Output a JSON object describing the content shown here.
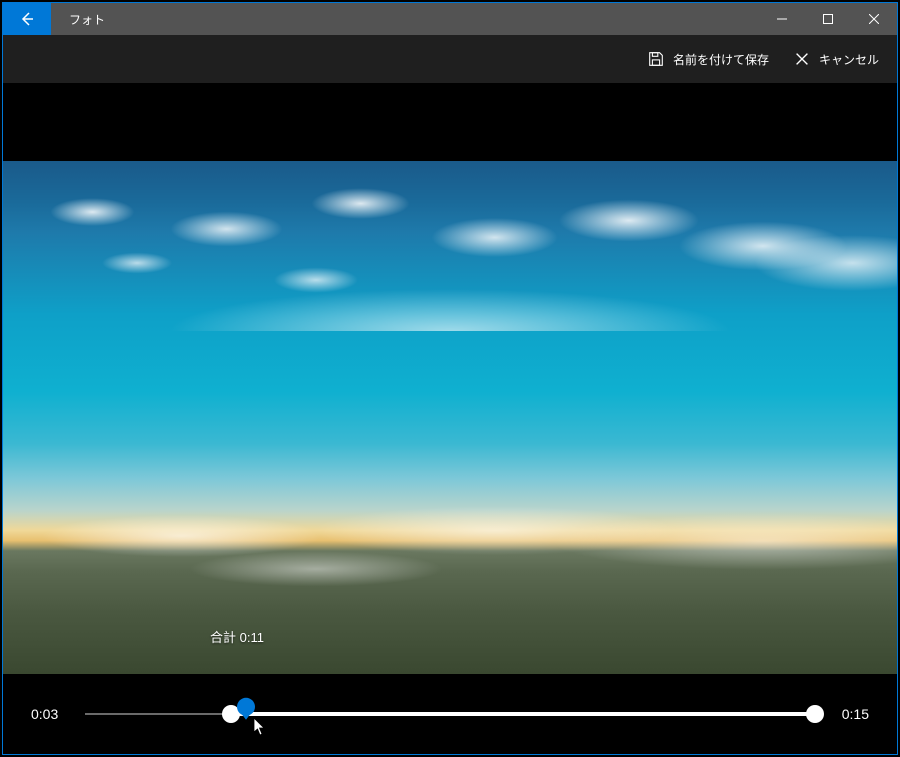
{
  "titlebar": {
    "title": "フォト"
  },
  "toolbar": {
    "save_as_label": "名前を付けて保存",
    "cancel_label": "キャンセル"
  },
  "trim": {
    "tooltip_prefix": "合計 ",
    "tooltip_time": "0:11",
    "start_time": "0:03",
    "end_time": "0:15",
    "start_pct": 20,
    "end_pct": 100,
    "playhead_pct": 22
  },
  "colors": {
    "accent": "#0078d7"
  }
}
